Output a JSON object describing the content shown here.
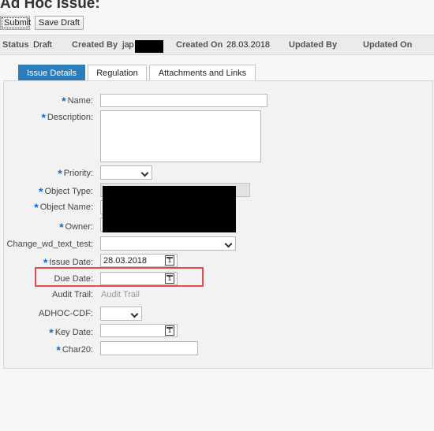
{
  "page": {
    "title": "Ad Hoc Issue:"
  },
  "toolbar": {
    "submit_label": "Submit",
    "save_draft_label": "Save Draft"
  },
  "status_bar": {
    "status_label": "Status",
    "status_value": "Draft",
    "created_by_label": "Created By",
    "created_by_value": "jap",
    "created_on_label": "Created On",
    "created_on_value": "28.03.2018",
    "updated_by_label": "Updated By",
    "updated_on_label": "Updated On"
  },
  "tabs": [
    {
      "label": "Issue Details",
      "active": true
    },
    {
      "label": "Regulation",
      "active": false
    },
    {
      "label": "Attachments and Links",
      "active": false
    }
  ],
  "form": {
    "required_marker": "*",
    "name": {
      "label": "Name:",
      "value": ""
    },
    "description": {
      "label": "Description:",
      "value": ""
    },
    "priority": {
      "label": "Priority:",
      "value": ""
    },
    "object_type": {
      "label": "Object Type:"
    },
    "object_name": {
      "label": "Object Name:"
    },
    "owner": {
      "label": "Owner:"
    },
    "change_wd_text_test": {
      "label": "Change_wd_text_test:",
      "value": ""
    },
    "issue_date": {
      "label": "Issue Date:",
      "value": "28.03.2018"
    },
    "due_date": {
      "label": "Due Date:",
      "value": ""
    },
    "audit_trail": {
      "label": "Audit Trail:",
      "value": "Audit Trail"
    },
    "adhoc_cdf": {
      "label": "ADHOC-CDF:",
      "value": ""
    },
    "key_date": {
      "label": "Key Date:",
      "value": ""
    },
    "char20": {
      "label": "Char20:",
      "value": ""
    }
  },
  "icons": {
    "calendar": "calendar-icon",
    "dropdown": "chevron-down-icon",
    "calendar_glyph": "1"
  },
  "colors": {
    "accent": "#2b7dbc",
    "required": "#0a6ed1",
    "highlight": "#e0504a"
  }
}
